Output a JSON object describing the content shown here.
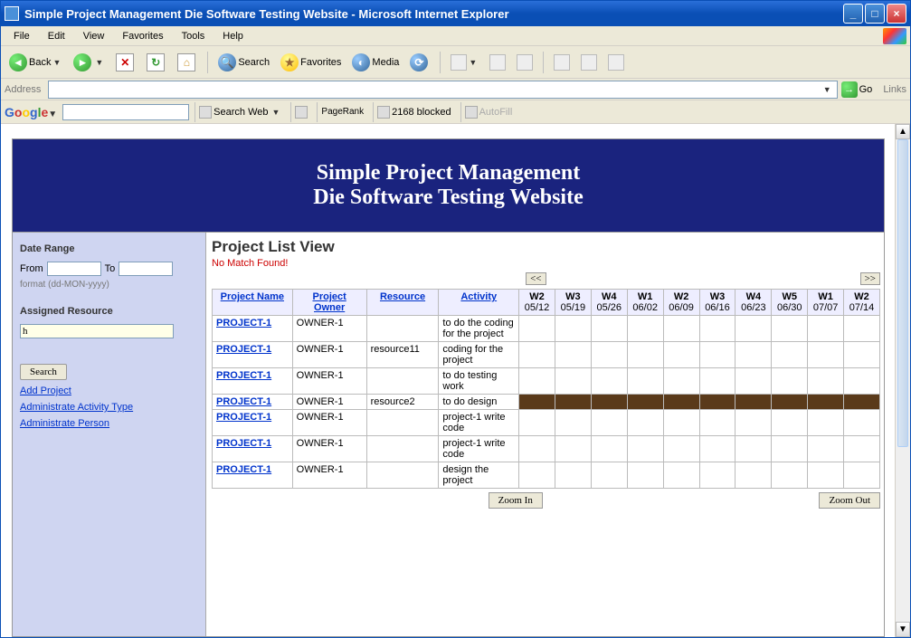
{
  "window": {
    "title": "Simple Project Management Die Software Testing Website - Microsoft Internet Explorer"
  },
  "menu": {
    "file": "File",
    "edit": "Edit",
    "view": "View",
    "favorites": "Favorites",
    "tools": "Tools",
    "help": "Help"
  },
  "toolbar": {
    "back": "Back",
    "search": "Search",
    "favorites": "Favorites",
    "media": "Media"
  },
  "address": {
    "label": "Address",
    "value": "",
    "go": "Go",
    "links": "Links"
  },
  "google": {
    "search_web": "Search Web",
    "pagerank": "PageRank",
    "blocked": "2168 blocked",
    "autofill": "AutoFill"
  },
  "banner": {
    "line1": "Simple Project Management",
    "line2": "Die Software Testing Website"
  },
  "sidebar": {
    "date_range": "Date Range",
    "from": "From",
    "to": "To",
    "format": "format (dd-MON-yyyy)",
    "assigned": "Assigned Resource",
    "assigned_value": "h",
    "search": "Search",
    "add_project": "Add Project",
    "admin_activity": "Administrate Activity Type",
    "admin_person": "Administrate Person"
  },
  "main": {
    "title": "Project List View",
    "nomatch": "No Match Found!",
    "prev": "<<",
    "next": ">>",
    "zoom_in": "Zoom In",
    "zoom_out": "Zoom Out",
    "headers": {
      "name": "Project Name",
      "owner": "Project Owner",
      "resource": "Resource",
      "activity": "Activity"
    },
    "weeks": [
      {
        "w": "W2",
        "d": "05/12"
      },
      {
        "w": "W3",
        "d": "05/19"
      },
      {
        "w": "W4",
        "d": "05/26"
      },
      {
        "w": "W1",
        "d": "06/02"
      },
      {
        "w": "W2",
        "d": "06/09"
      },
      {
        "w": "W3",
        "d": "06/16"
      },
      {
        "w": "W4",
        "d": "06/23"
      },
      {
        "w": "W5",
        "d": "06/30"
      },
      {
        "w": "W1",
        "d": "07/07"
      },
      {
        "w": "W2",
        "d": "07/14"
      }
    ],
    "rows": [
      {
        "name": "PROJECT-1",
        "owner": "OWNER-1",
        "resource": "",
        "activity": "to do the coding for the project",
        "bar": false
      },
      {
        "name": "PROJECT-1",
        "owner": "OWNER-1",
        "resource": "resource11",
        "activity": "coding for the project",
        "bar": false
      },
      {
        "name": "PROJECT-1",
        "owner": "OWNER-1",
        "resource": "",
        "activity": "to do testing work",
        "bar": false
      },
      {
        "name": "PROJECT-1",
        "owner": "OWNER-1",
        "resource": "resource2",
        "activity": "to do design",
        "bar": true
      },
      {
        "name": "PROJECT-1",
        "owner": "OWNER-1",
        "resource": "",
        "activity": "project-1 write code",
        "bar": false
      },
      {
        "name": "PROJECT-1",
        "owner": "OWNER-1",
        "resource": "",
        "activity": "project-1 write code",
        "bar": false
      },
      {
        "name": "PROJECT-1",
        "owner": "OWNER-1",
        "resource": "",
        "activity": "design the project",
        "bar": false
      }
    ]
  }
}
